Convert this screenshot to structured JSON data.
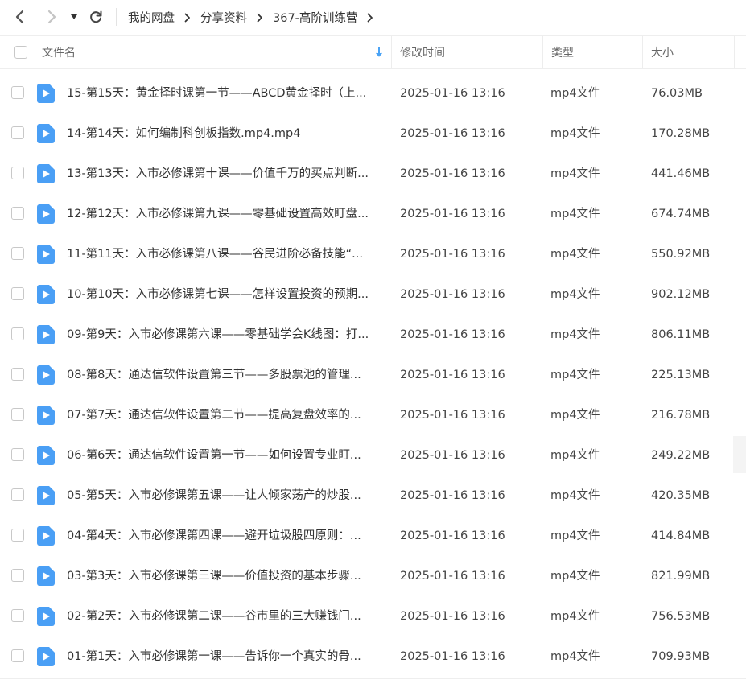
{
  "breadcrumb": [
    "我的网盘",
    "分享资料",
    "367-高阶训练营"
  ],
  "columns": {
    "name": "文件名",
    "modified": "修改时间",
    "type": "类型",
    "size": "大小"
  },
  "files": [
    {
      "name": "15-第15天：黄金择时课第一节——ABCD黄金择时（上...",
      "modified": "2025-01-16 13:16",
      "type": "mp4文件",
      "size": "76.03MB"
    },
    {
      "name": "14-第14天：如何编制科创板指数.mp4.mp4",
      "modified": "2025-01-16 13:16",
      "type": "mp4文件",
      "size": "170.28MB"
    },
    {
      "name": "13-第13天：入市必修课第十课——价值千万的买点判断...",
      "modified": "2025-01-16 13:16",
      "type": "mp4文件",
      "size": "441.46MB"
    },
    {
      "name": "12-第12天：入市必修课第九课——零基础设置高效盯盘...",
      "modified": "2025-01-16 13:16",
      "type": "mp4文件",
      "size": "674.74MB"
    },
    {
      "name": "11-第11天：入市必修课第八课——谷民进阶必备技能“...",
      "modified": "2025-01-16 13:16",
      "type": "mp4文件",
      "size": "550.92MB"
    },
    {
      "name": "10-第10天：入市必修课第七课——怎样设置投资的预期...",
      "modified": "2025-01-16 13:16",
      "type": "mp4文件",
      "size": "902.12MB"
    },
    {
      "name": "09-第9天：入市必修课第六课——零基础学会K线图：打...",
      "modified": "2025-01-16 13:16",
      "type": "mp4文件",
      "size": "806.11MB"
    },
    {
      "name": "08-第8天：通达信软件设置第三节——多股票池的管理...",
      "modified": "2025-01-16 13:16",
      "type": "mp4文件",
      "size": "225.13MB"
    },
    {
      "name": "07-第7天：通达信软件设置第二节——提高复盘效率的...",
      "modified": "2025-01-16 13:16",
      "type": "mp4文件",
      "size": "216.78MB"
    },
    {
      "name": "06-第6天：通达信软件设置第一节——如何设置专业盯...",
      "modified": "2025-01-16 13:16",
      "type": "mp4文件",
      "size": "249.22MB"
    },
    {
      "name": "05-第5天：入市必修课第五课——让人倾家荡产的炒股...",
      "modified": "2025-01-16 13:16",
      "type": "mp4文件",
      "size": "420.35MB"
    },
    {
      "name": "04-第4天：入市必修课第四课——避开垃圾股四原则：...",
      "modified": "2025-01-16 13:16",
      "type": "mp4文件",
      "size": "414.84MB"
    },
    {
      "name": "03-第3天：入市必修课第三课——价值投资的基本步骤...",
      "modified": "2025-01-16 13:16",
      "type": "mp4文件",
      "size": "821.99MB"
    },
    {
      "name": "02-第2天：入市必修课第二课——谷市里的三大赚钱门...",
      "modified": "2025-01-16 13:16",
      "type": "mp4文件",
      "size": "756.53MB"
    },
    {
      "name": "01-第1天：入市必修课第一课——告诉你一个真实的骨...",
      "modified": "2025-01-16 13:16",
      "type": "mp4文件",
      "size": "709.93MB"
    }
  ],
  "icons": {
    "back": "chevron-left-icon",
    "forward": "chevron-right-icon",
    "history": "caret-down-icon",
    "refresh": "refresh-icon",
    "file": "video-file-icon",
    "sort": "sort-arrow-down-icon"
  },
  "colors": {
    "accent": "#4aa3f5",
    "file_icon": "#4a9ff5"
  }
}
